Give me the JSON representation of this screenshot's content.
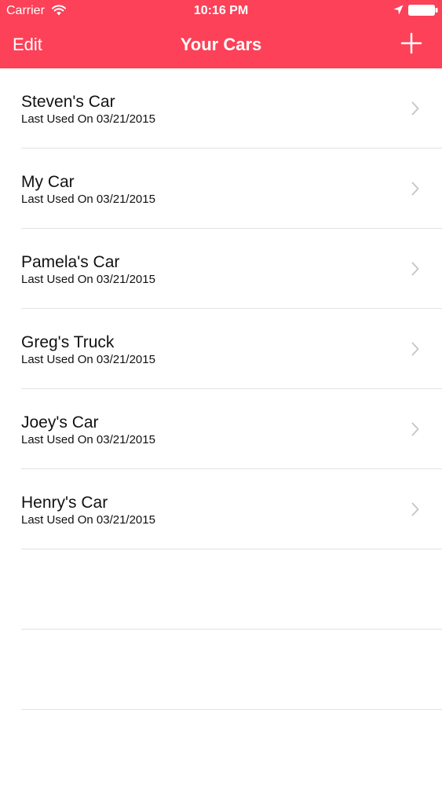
{
  "status_bar": {
    "carrier": "Carrier",
    "time": "10:16 PM"
  },
  "nav": {
    "edit_label": "Edit",
    "title": "Your Cars",
    "add_icon": "plus-icon"
  },
  "colors": {
    "accent": "#fc4158",
    "separator": "#e3e3e6",
    "chevron": "#c7c7cc"
  },
  "cars": [
    {
      "name": "Steven's Car",
      "last_used": "Last Used On 03/21/2015"
    },
    {
      "name": "My Car",
      "last_used": "Last Used On 03/21/2015"
    },
    {
      "name": "Pamela's Car",
      "last_used": "Last Used On 03/21/2015"
    },
    {
      "name": "Greg's Truck",
      "last_used": "Last Used On 03/21/2015"
    },
    {
      "name": "Joey's Car",
      "last_used": "Last Used On 03/21/2015"
    },
    {
      "name": "Henry's Car",
      "last_used": "Last Used On 03/21/2015"
    }
  ]
}
